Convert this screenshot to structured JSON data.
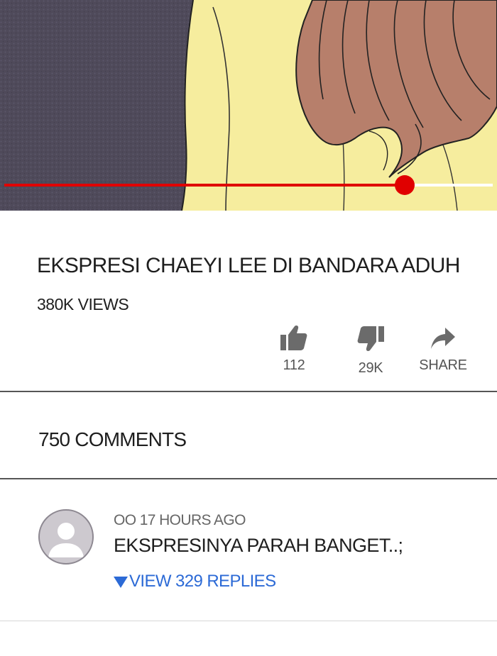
{
  "video": {
    "progress_fraction": 0.82,
    "colors": {
      "played": "#e00000",
      "unplayed": "#ffffff",
      "background_left": "#4f4a5a",
      "background_right": "#f6ed9e",
      "hair": "#b77f6b"
    }
  },
  "info": {
    "title": "EKSPRESI CHAEYI LEE DI BANDARA ADUH",
    "views": "380K VIEWS"
  },
  "actions": {
    "like": {
      "icon": "thumbs-up-icon",
      "count": "112"
    },
    "dislike": {
      "icon": "thumbs-down-icon",
      "count": "29K"
    },
    "share": {
      "icon": "share-arrow-icon",
      "label": "SHARE"
    }
  },
  "comments": {
    "count_label": "750 COMMENTS",
    "items": [
      {
        "avatar_icon": "default-avatar-icon",
        "meta": "OO 17 HOURS AGO",
        "text": "EKSPRESINYA PARAH BANGET..;",
        "replies_label": "VIEW 329 REPLIES"
      }
    ]
  }
}
